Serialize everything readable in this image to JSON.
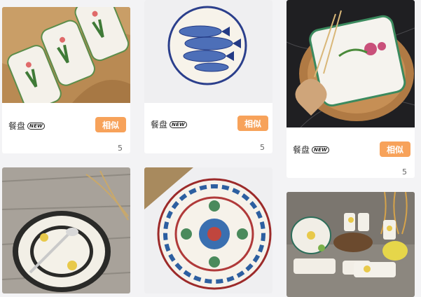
{
  "cards": [
    {
      "title": "餐盘",
      "badge": "NEW",
      "similar": "相似",
      "count": "5"
    },
    {
      "title": "餐盘",
      "badge": "NEW",
      "similar": "相似",
      "count": "5"
    },
    {
      "title": "餐盘",
      "badge": "NEW",
      "similar": "相似",
      "count": "5"
    }
  ],
  "colors": {
    "accent": "#f7a25a",
    "background": "#f3f3f5"
  }
}
